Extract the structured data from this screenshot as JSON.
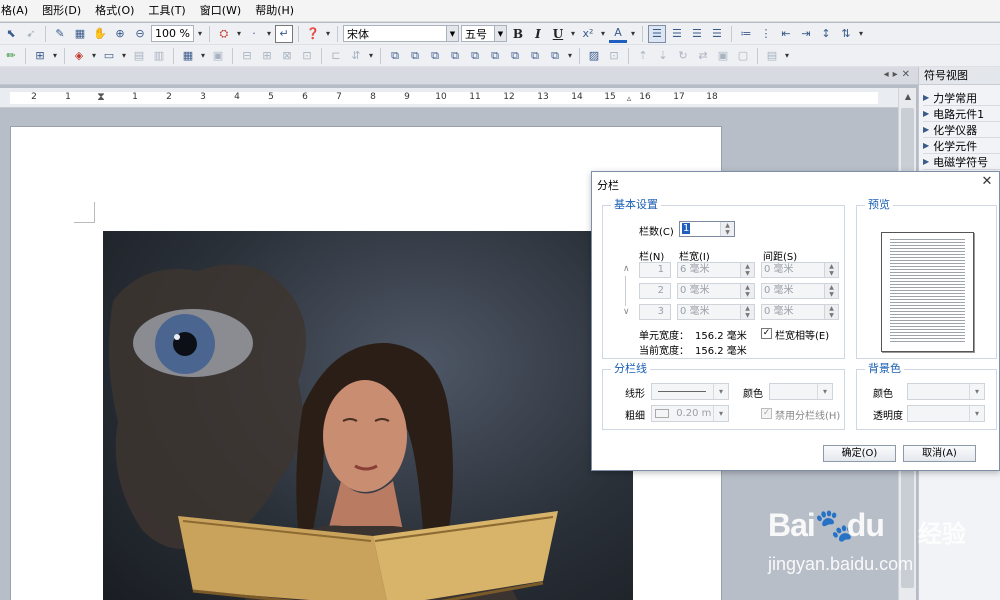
{
  "menubar": {
    "items": [
      "格(A)",
      "图形(D)",
      "格式(O)",
      "工具(T)",
      "窗口(W)",
      "帮助(H)"
    ]
  },
  "toolbar": {
    "zoom": "100 %",
    "font_name": "宋体",
    "font_size": "五号",
    "bold": "B",
    "italic": "I",
    "underline": "U"
  },
  "ruler": {
    "numbers": [
      "2",
      "1",
      "1",
      "2",
      "3",
      "4",
      "5",
      "6",
      "7",
      "8",
      "9",
      "10",
      "11",
      "12",
      "13",
      "14",
      "15",
      "16",
      "17",
      "18"
    ]
  },
  "symbol_panel": {
    "title": "符号视图",
    "items": [
      "力学常用",
      "电路元件1",
      "化学仪器",
      "化学元件",
      "电磁学符号"
    ]
  },
  "dialog": {
    "title": "分栏",
    "basic": {
      "legend": "基本设置",
      "column_count_label": "栏数(C)",
      "column_count_value": "1",
      "col_header": "栏(N)",
      "width_header": "栏宽(I)",
      "spacing_header": "间距(S)",
      "rows": [
        {
          "num": "1",
          "width": "6 毫米",
          "spacing": "0 毫米"
        },
        {
          "num": "2",
          "width": "0 毫米",
          "spacing": "0 毫米"
        },
        {
          "num": "3",
          "width": "0 毫米",
          "spacing": "0 毫米"
        }
      ],
      "unit_width_label": "单元宽度：",
      "unit_width_value": "156.2 毫米",
      "current_width_label": "当前宽度：",
      "current_width_value": "156.2 毫米",
      "equal_width_label": "栏宽相等(E)"
    },
    "preview": {
      "legend": "预览"
    },
    "divider": {
      "legend": "分栏线",
      "line_shape_label": "线形",
      "color_label": "颜色",
      "thickness_label": "粗细",
      "thickness_value": "0.20 m",
      "disable_label": "禁用分栏线(H)"
    },
    "background": {
      "legend": "背景色",
      "color_label": "颜色",
      "transparency_label": "透明度"
    },
    "ok_label": "确定(O)",
    "cancel_label": "取消(A)"
  },
  "watermark": {
    "brand_a": "Bai",
    "brand_b": "du",
    "brand_cn": "经验",
    "url": "jingyan.baidu.com"
  }
}
